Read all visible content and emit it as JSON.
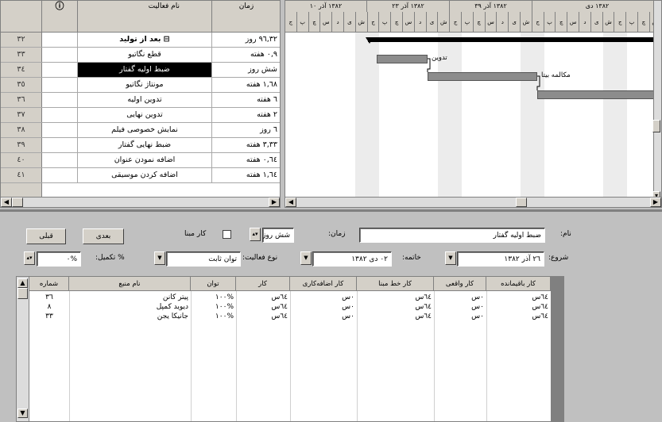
{
  "task_grid": {
    "headers": {
      "info": "",
      "name": "نام فعالیت",
      "duration": "زمان"
    },
    "rows": [
      {
        "id": "٣٢",
        "name": "بعد از تولید",
        "duration": "٩٦,٣٢ روز",
        "summary": true
      },
      {
        "id": "٣٣",
        "name": "قطع نگاتیو",
        "duration": "٠,٩ هفته"
      },
      {
        "id": "٣٤",
        "name": "ضبط اولیه گفتار",
        "duration": "شش روز",
        "selected": true
      },
      {
        "id": "٣٥",
        "name": "مونتاژ نگاتیو",
        "duration": "١,٦٨ هفته"
      },
      {
        "id": "٣٦",
        "name": "تدوین اولیه",
        "duration": "٦ هفته"
      },
      {
        "id": "٣٧",
        "name": "تدوین نهایی",
        "duration": "٢ هفته"
      },
      {
        "id": "٣٨",
        "name": "نمایش خصوصی فیلم",
        "duration": "٦ روز"
      },
      {
        "id": "٣٩",
        "name": "ضبط نهایی گفتار",
        "duration": "٣,٣٣ هفته"
      },
      {
        "id": "٤٠",
        "name": "اضافه نمودن عنوان",
        "duration": "٠,٦٤ هفته"
      },
      {
        "id": "٤١",
        "name": "اضافه کردن موسیقی",
        "duration": "١,٦٤ هفته"
      }
    ]
  },
  "gantt": {
    "weeks": [
      "١٣٨٢ آذر ١٠",
      "١٣٨٢ آذر ٢٣",
      "١٣٨٢ آذر ٣٩",
      "١٣٨٢ دی"
    ],
    "days": [
      "ج",
      "پ",
      "چ",
      "س",
      "د",
      "ی",
      "ش",
      "ج",
      "پ",
      "چ",
      "س",
      "د",
      "ی",
      "ش",
      "ج",
      "پ",
      "چ",
      "س",
      "د",
      "ی",
      "ش",
      "ج",
      "پ",
      "چ",
      "س",
      "د",
      "ی",
      "ش",
      "ج",
      "پ",
      "چ",
      "س"
    ],
    "bar_labels": [
      "تدوین",
      "مکالمه بیتا"
    ]
  },
  "form": {
    "name_label": "نام:",
    "name_value": "ضبط اولیه گفتار",
    "duration_label": "زمان:",
    "duration_value": "شش روز",
    "estimated_label": "کار مبنا",
    "prev_button": "قبلی",
    "next_button": "بعدی",
    "start_label": "شروع:",
    "start_value": "٢٦ آذر ١٣٨٢",
    "finish_label": "خاتمه:",
    "finish_value": "٠٢ دی ١٣٨٢",
    "task_type_label": "نوع فعالیت:",
    "task_type_value": "توان ثابت",
    "pct_complete_label": "% تکمیل:",
    "pct_complete_value": "%٠"
  },
  "resources": {
    "headers": [
      "شماره",
      "نام منبع",
      "توان",
      "کار",
      "کار اضافه‌کاری",
      "کار خط مبنا",
      "کار واقعی",
      "کار باقیمانده"
    ],
    "rows": [
      [
        "٣٦",
        "پیتر کانن",
        "%١٠٠",
        "٦٤س",
        "٠س",
        "٦٤س",
        "٠س",
        "٦٤س"
      ],
      [
        "٨",
        "دیوید کمپل",
        "%١٠٠",
        "٦٤س",
        "٠س",
        "٦٤س",
        "٠س",
        "٦٤س"
      ],
      [
        "٣٣",
        "جانیکا یجن",
        "%١٠٠",
        "٦٤س",
        "٠س",
        "٦٤س",
        "٠س",
        "٦٤س"
      ]
    ]
  }
}
